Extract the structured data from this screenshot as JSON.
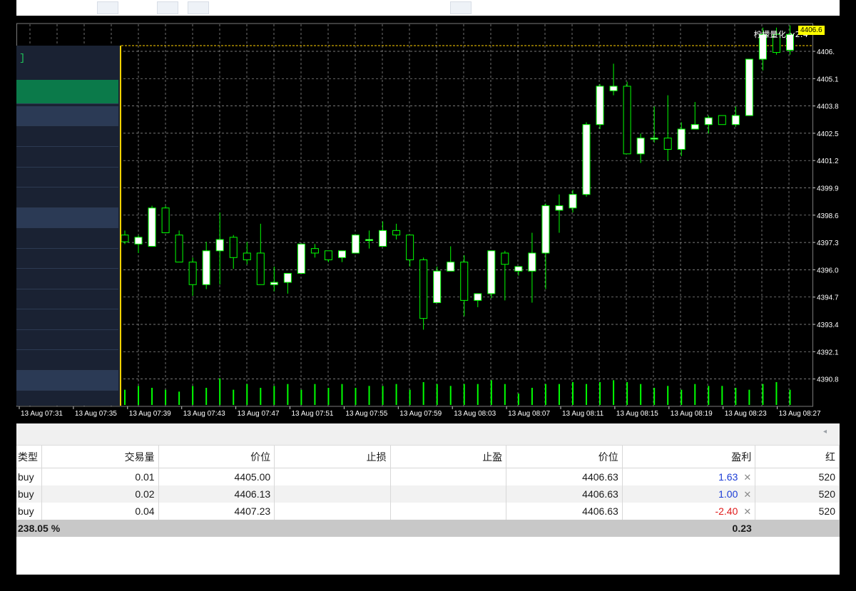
{
  "chart": {
    "ea_label": "柠檬量化_v2.4",
    "current_price_tag": "4406.6",
    "price_axis": [
      "4406.",
      "4405.1",
      "4403.8",
      "4402.5",
      "4401.2",
      "4399.9",
      "4398.6",
      "4397.3",
      "4396.0",
      "4394.7",
      "4393.4",
      "4392.1",
      "4390.8"
    ],
    "time_axis": [
      "13 Aug 07:31",
      "13 Aug 07:35",
      "13 Aug 07:39",
      "13 Aug 07:43",
      "13 Aug 07:47",
      "13 Aug 07:51",
      "13 Aug 07:55",
      "13 Aug 07:59",
      "13 Aug 08:03",
      "13 Aug 08:07",
      "13 Aug 08:11",
      "13 Aug 08:15",
      "13 Aug 08:19",
      "13 Aug 08:23",
      "13 Aug 08:27"
    ],
    "colors": {
      "bull_body": "#ffffff",
      "bear_body": "#000000",
      "wick": "#00ff00",
      "grid": "#c8c8c8",
      "volume": "#00ff00",
      "current_line": "#ffd200",
      "panel_highlight": "#0b7a4a"
    },
    "left_panel_bracket": "]"
  },
  "chart_data": {
    "type": "candlestick",
    "candles": [
      {
        "o": 4397.6,
        "h": 4397.8,
        "l": 4397.2,
        "c": 4397.3
      },
      {
        "o": 4397.2,
        "h": 4397.6,
        "l": 4396.8,
        "c": 4397.5
      },
      {
        "o": 4397.1,
        "h": 4398.9,
        "l": 4397.1,
        "c": 4398.8
      },
      {
        "o": 4398.8,
        "h": 4398.9,
        "l": 4397.7,
        "c": 4397.7
      },
      {
        "o": 4397.6,
        "h": 4397.8,
        "l": 4396.5,
        "c": 4396.4
      },
      {
        "o": 4396.4,
        "h": 4396.6,
        "l": 4394.9,
        "c": 4395.4
      },
      {
        "o": 4395.4,
        "h": 4397.3,
        "l": 4395.2,
        "c": 4396.9
      },
      {
        "o": 4396.9,
        "h": 4398.6,
        "l": 4395.4,
        "c": 4397.4
      },
      {
        "o": 4397.5,
        "h": 4397.6,
        "l": 4396.1,
        "c": 4396.6
      },
      {
        "o": 4396.8,
        "h": 4397.3,
        "l": 4396.3,
        "c": 4396.5
      },
      {
        "o": 4396.8,
        "h": 4398.1,
        "l": 4395.4,
        "c": 4395.4
      },
      {
        "o": 4395.4,
        "h": 4396.2,
        "l": 4395.1,
        "c": 4395.5
      },
      {
        "o": 4395.5,
        "h": 4395.9,
        "l": 4395.0,
        "c": 4395.9
      },
      {
        "o": 4395.9,
        "h": 4397.2,
        "l": 4395.9,
        "c": 4397.2
      },
      {
        "o": 4397.0,
        "h": 4397.2,
        "l": 4396.6,
        "c": 4396.8
      },
      {
        "o": 4396.9,
        "h": 4396.9,
        "l": 4396.4,
        "c": 4396.5
      },
      {
        "o": 4396.6,
        "h": 4396.9,
        "l": 4396.4,
        "c": 4396.9
      },
      {
        "o": 4396.8,
        "h": 4397.6,
        "l": 4396.8,
        "c": 4397.6
      },
      {
        "o": 4397.4,
        "h": 4397.8,
        "l": 4397.0,
        "c": 4397.4
      },
      {
        "o": 4397.1,
        "h": 4398.2,
        "l": 4397.1,
        "c": 4397.8
      },
      {
        "o": 4397.8,
        "h": 4398.1,
        "l": 4397.4,
        "c": 4397.6
      },
      {
        "o": 4397.6,
        "h": 4397.6,
        "l": 4396.2,
        "c": 4396.5
      },
      {
        "o": 4396.5,
        "h": 4396.6,
        "l": 4393.4,
        "c": 4393.9
      },
      {
        "o": 4394.6,
        "h": 4396.2,
        "l": 4394.6,
        "c": 4396.0
      },
      {
        "o": 4396.0,
        "h": 4397.1,
        "l": 4396.0,
        "c": 4396.4
      },
      {
        "o": 4396.4,
        "h": 4396.7,
        "l": 4394.0,
        "c": 4394.7
      },
      {
        "o": 4394.7,
        "h": 4395.0,
        "l": 4394.4,
        "c": 4395.0
      },
      {
        "o": 4395.0,
        "h": 4396.9,
        "l": 4394.8,
        "c": 4396.9
      },
      {
        "o": 4396.8,
        "h": 4396.9,
        "l": 4394.7,
        "c": 4396.3
      },
      {
        "o": 4396.0,
        "h": 4396.2,
        "l": 4395.8,
        "c": 4396.2
      },
      {
        "o": 4396.0,
        "h": 4397.7,
        "l": 4394.6,
        "c": 4396.8
      },
      {
        "o": 4396.8,
        "h": 4399.0,
        "l": 4395.2,
        "c": 4398.9
      },
      {
        "o": 4398.7,
        "h": 4399.4,
        "l": 4397.7,
        "c": 4398.9
      },
      {
        "o": 4398.8,
        "h": 4399.6,
        "l": 4398.6,
        "c": 4399.4
      },
      {
        "o": 4399.4,
        "h": 4402.6,
        "l": 4399.3,
        "c": 4402.5
      },
      {
        "o": 4402.5,
        "h": 4404.3,
        "l": 4402.3,
        "c": 4404.2
      },
      {
        "o": 4404.0,
        "h": 4405.2,
        "l": 4403.8,
        "c": 4404.2
      },
      {
        "o": 4404.2,
        "h": 4404.4,
        "l": 4401.2,
        "c": 4401.2
      },
      {
        "o": 4401.2,
        "h": 4402.1,
        "l": 4400.8,
        "c": 4401.9
      },
      {
        "o": 4401.9,
        "h": 4403.3,
        "l": 4401.7,
        "c": 4401.9
      },
      {
        "o": 4401.9,
        "h": 4403.8,
        "l": 4400.9,
        "c": 4401.4
      },
      {
        "o": 4401.4,
        "h": 4402.6,
        "l": 4401.1,
        "c": 4402.3
      },
      {
        "o": 4402.3,
        "h": 4403.5,
        "l": 4402.3,
        "c": 4402.5
      },
      {
        "o": 4402.5,
        "h": 4402.9,
        "l": 4402.1,
        "c": 4402.8
      },
      {
        "o": 4402.9,
        "h": 4402.9,
        "l": 4402.5,
        "c": 4402.5
      },
      {
        "o": 4402.5,
        "h": 4403.3,
        "l": 4402.4,
        "c": 4402.9
      },
      {
        "o": 4402.9,
        "h": 4405.4,
        "l": 4402.9,
        "c": 4405.4
      },
      {
        "o": 4405.4,
        "h": 4406.8,
        "l": 4404.9,
        "c": 4406.5
      },
      {
        "o": 4406.5,
        "h": 4406.8,
        "l": 4405.6,
        "c": 4405.7
      },
      {
        "o": 4405.8,
        "h": 4406.9,
        "l": 4405.6,
        "c": 4406.5
      }
    ],
    "volume": [
      8,
      10,
      9,
      8,
      7,
      10,
      9,
      14,
      8,
      11,
      9,
      10,
      11,
      8,
      11,
      9,
      11,
      9,
      10,
      10,
      11,
      8,
      12,
      11,
      10,
      11,
      11,
      13,
      11,
      6,
      9,
      11,
      11,
      12,
      11,
      12,
      13,
      12,
      11,
      9,
      10,
      8,
      11,
      10,
      10,
      9,
      8,
      11,
      12,
      8
    ],
    "volume_max": 15,
    "ylim": [
      4390.0,
      4406.95
    ]
  },
  "terminal": {
    "scroll_arrow": "◂",
    "columns": [
      "类型",
      "交易量",
      "价位",
      "止损",
      "止盈",
      "价位",
      "盈利",
      "红"
    ],
    "rows": [
      {
        "type": "buy",
        "volume": "0.01",
        "open_price": "4405.00",
        "sl": "",
        "tp": "",
        "price": "4406.63",
        "profit": "1.63",
        "profit_sign": "pos",
        "extra": "520"
      },
      {
        "type": "buy",
        "volume": "0.02",
        "open_price": "4406.13",
        "sl": "",
        "tp": "",
        "price": "4406.63",
        "profit": "1.00",
        "profit_sign": "pos",
        "extra": "520"
      },
      {
        "type": "buy",
        "volume": "0.04",
        "open_price": "4407.23",
        "sl": "",
        "tp": "",
        "price": "4406.63",
        "profit": "-2.40",
        "profit_sign": "neg",
        "extra": "520"
      }
    ],
    "close_icon": "✕",
    "summary": {
      "margin_level": "238.05 %",
      "total_profit": "0.23"
    }
  }
}
